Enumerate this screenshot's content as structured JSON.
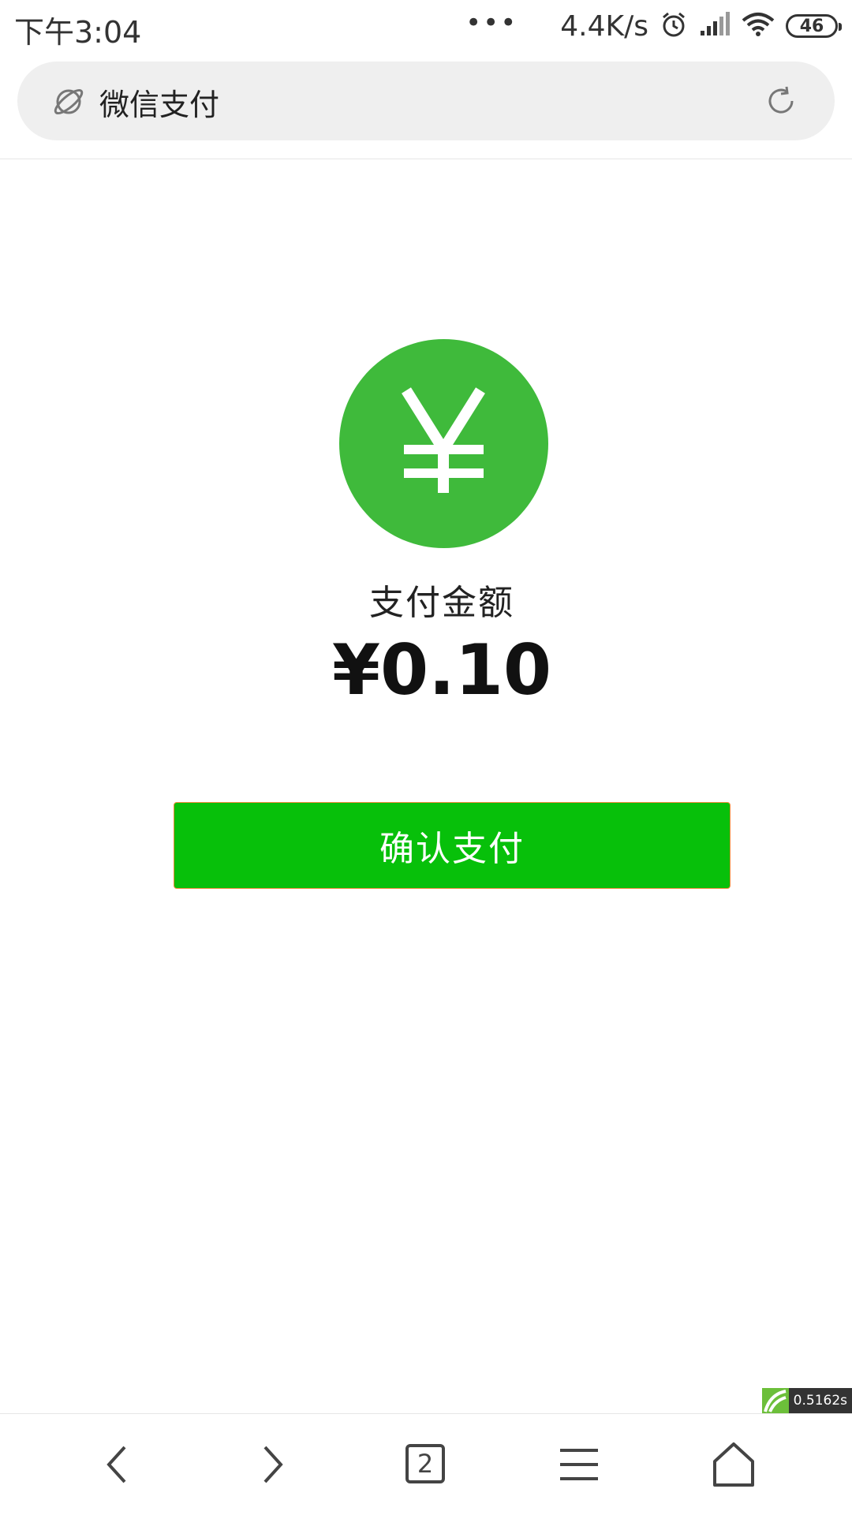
{
  "status_bar": {
    "time": "下午3:04",
    "dots": "•••",
    "network_speed": "4.4K/s",
    "battery": "46"
  },
  "url_bar": {
    "title": "微信支付"
  },
  "payment": {
    "amount_label": "支付金额",
    "amount": "¥0.10",
    "confirm_label": "确认支付",
    "accent_color": "#07c00a",
    "coin_color": "#3fba3b"
  },
  "overlay": {
    "timer": "0.5162s"
  },
  "bottom_nav": {
    "tab_count": "2",
    "icons": [
      "back-icon",
      "forward-icon",
      "tabs-icon",
      "menu-icon",
      "home-icon"
    ]
  }
}
